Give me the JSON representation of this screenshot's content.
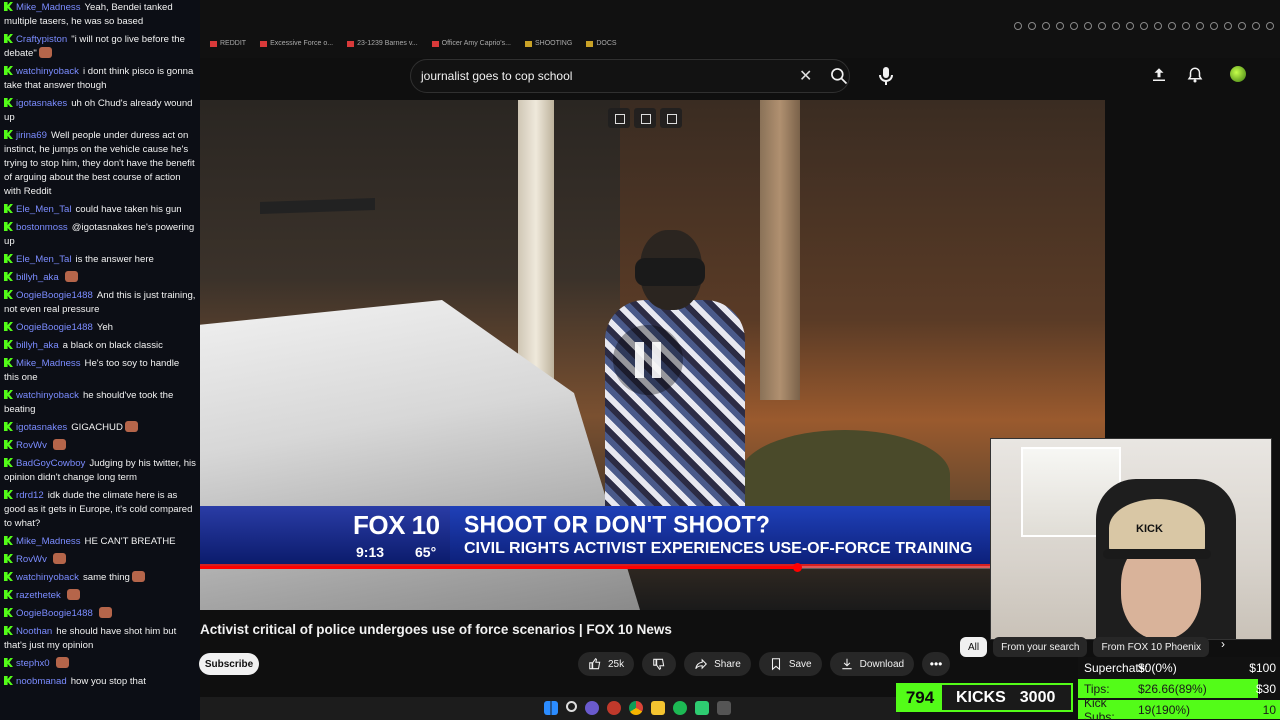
{
  "chat": {
    "messages": [
      {
        "user": "Mike_Madness",
        "text": "Yeah, Bendei tanked multiple tasers, he was so based",
        "emote": false
      },
      {
        "user": "Craftypiston",
        "text": "\"i will not go live before the debate\"",
        "emote": true
      },
      {
        "user": "watchinyoback",
        "text": "i dont think pisco is gonna take that answer though",
        "emote": false
      },
      {
        "user": "igotasnakes",
        "text": "uh oh Chud's already wound up",
        "emote": false
      },
      {
        "user": "jirina69",
        "text": "Well people under duress act on instinct, he jumps on the vehicle cause he's trying to stop him, they don't have the benefit of arguing about the best course of action with Reddit",
        "emote": false
      },
      {
        "user": "Ele_Men_Tal",
        "text": "could have taken his gun",
        "emote": false
      },
      {
        "user": "bostonmoss",
        "text": "@igotasnakes he's powering up",
        "emote": false
      },
      {
        "user": "Ele_Men_Tal",
        "text": "is the answer here",
        "emote": false
      },
      {
        "user": "billyh_aka",
        "text": "",
        "emote": true
      },
      {
        "user": "OogieBoogie1488",
        "text": "And this is just training, not even real pressure",
        "emote": false
      },
      {
        "user": "OogieBoogie1488",
        "text": "Yeh",
        "emote": false
      },
      {
        "user": "billyh_aka",
        "text": "a black on black classic",
        "emote": false
      },
      {
        "user": "Mike_Madness",
        "text": "He's too soy to handle this one",
        "emote": false
      },
      {
        "user": "watchinyoback",
        "text": "he should've took the beating",
        "emote": false
      },
      {
        "user": "igotasnakes",
        "text": "GIGACHUD",
        "emote": true
      },
      {
        "user": "RovWv",
        "text": "",
        "emote": true
      },
      {
        "user": "BadGoyCowboy",
        "text": "Judging by his twitter, his opinion didn't change long term",
        "emote": false
      },
      {
        "user": "rdrd12",
        "text": "idk dude the climate here is as good as it gets in Europe, it's cold compared to what?",
        "emote": false
      },
      {
        "user": "Mike_Madness",
        "text": "HE CAN'T BREATHE",
        "emote": false
      },
      {
        "user": "RovWv",
        "text": "",
        "emote": true
      },
      {
        "user": "watchinyoback",
        "text": "same thing",
        "emote": true
      },
      {
        "user": "razethetek",
        "text": "",
        "emote": true
      },
      {
        "user": "OogieBoogie1488",
        "text": "",
        "emote": true
      },
      {
        "user": "Noothan",
        "text": "he should have shot him but that's just my opinion",
        "emote": false
      },
      {
        "user": "stephx0",
        "text": "",
        "emote": true
      },
      {
        "user": "noobmanad",
        "text": "how you stop that",
        "emote": false
      }
    ]
  },
  "bookmarks": [
    "REDDIT",
    "Excessive Force o...",
    "23-1239 Barnes v...",
    "Officer Amy Caprio's...",
    "SHOOTING",
    "DOCS"
  ],
  "search": {
    "query": "journalist goes to cop school"
  },
  "video": {
    "brand": "FOX 10",
    "time": "9:13",
    "temp": "65°",
    "headline": "SHOOT OR DON'T SHOOT?",
    "subheadline": "CIVIL RIGHTS ACTIVIST EXPERIENCES USE-OF-FORCE TRAINING",
    "progress": 0.66,
    "title": "Activist critical of police undergoes use of force scenarios | FOX 10 News"
  },
  "webcam": {
    "cap_text": "KICK"
  },
  "actions": {
    "subscribe": "Subscribe",
    "likes": "25k",
    "share": "Share",
    "save": "Save",
    "download": "Download",
    "more": "•••"
  },
  "chips": [
    "All",
    "From your search",
    "From FOX 10 Phoenix"
  ],
  "kick": {
    "count": "794",
    "label": "KICKS",
    "goal": "3000"
  },
  "stats": [
    {
      "label": "Superchats:",
      "value": "$0(0%)",
      "goal": "$100",
      "fill": 0.0
    },
    {
      "label": "Tips:",
      "value": "$26.66(89%)",
      "goal": "$30",
      "fill": 0.89
    },
    {
      "label": "Kick Subs:",
      "value": "19(190%)",
      "goal": "10",
      "fill": 1.0
    }
  ],
  "colors": {
    "kick_green": "#53fc18",
    "youtube_red": "#ff0000",
    "chat_user": "#7b8cff"
  }
}
